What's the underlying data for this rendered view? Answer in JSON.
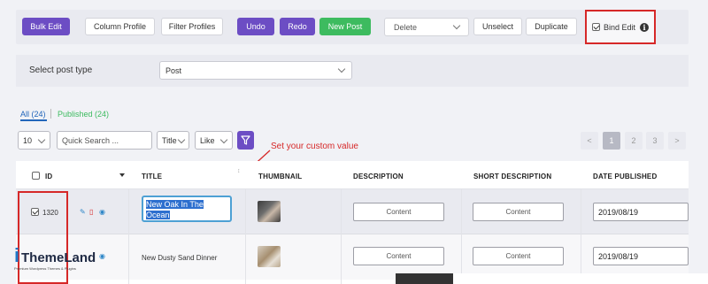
{
  "toolbar": {
    "bulk_edit": "Bulk Edit",
    "column_profile": "Column Profile",
    "filter_profiles": "Filter Profiles",
    "undo": "Undo",
    "redo": "Redo",
    "new_post": "New Post",
    "delete_value": "Delete",
    "unselect": "Unselect",
    "duplicate": "Duplicate",
    "bind_edit": "Bind Edit",
    "bind_edit_checked": true,
    "info_glyph": "i"
  },
  "post_type": {
    "label": "Select post type",
    "value": "Post"
  },
  "status_tabs": {
    "all": "All (24)",
    "published": "Published (24)"
  },
  "filters": {
    "per_page": "10",
    "search_placeholder": "Quick Search ...",
    "field": "Title",
    "operator": "Like"
  },
  "pagination": {
    "prev": "<",
    "pages": [
      "1",
      "2",
      "3"
    ],
    "next": ">",
    "current": "1"
  },
  "annotation": "Set your custom value",
  "table": {
    "columns": {
      "id": "ID",
      "title": "TITLE",
      "thumbnail": "THUMBNAIL",
      "description": "DESCRIPTION",
      "short_description": "SHORT DESCRIPTION",
      "date_published": "DATE PUBLISHED"
    },
    "rows": [
      {
        "id": "1320",
        "checked": true,
        "title_line1": "New Oak In The",
        "title_line2": "Ocean",
        "description": "Content",
        "short_description": "Content",
        "date_published": "2019/08/19"
      },
      {
        "id": "",
        "checked": false,
        "title": "New Dusty Sand Dinner",
        "description": "Content",
        "short_description": "Content",
        "date_published": "2019/08/19"
      }
    ]
  },
  "logo": {
    "brand_prefix": "i",
    "brand_name": "ThemeLand",
    "tagline": "Premium Wordpress Themes & Plugins"
  },
  "colors": {
    "accent_purple": "#6c4dc4",
    "accent_green": "#3dbb5f",
    "highlight_red": "#d62828",
    "link_blue": "#2266bb"
  }
}
